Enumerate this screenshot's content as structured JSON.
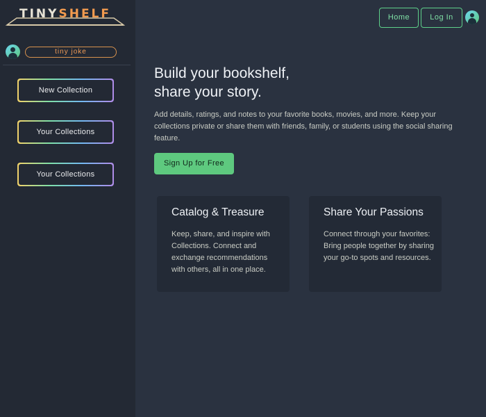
{
  "brand": {
    "part1": "TINY",
    "part2": "SHELF",
    "accent": "#f39b4f"
  },
  "sidebar": {
    "user": {
      "name": "tiny joke",
      "avatar_icon": "user-icon"
    },
    "buttons": [
      {
        "label": "New Collection"
      },
      {
        "label": "Your Collections"
      },
      {
        "label": "Your Collections"
      }
    ]
  },
  "nav": {
    "home": "Home",
    "login": "Log In",
    "avatar_icon": "user-icon"
  },
  "hero": {
    "title_line1": "Build your bookshelf,",
    "title_line2": "share your story.",
    "description": "Add details, ratings, and notes to your favorite books, movies, and more. Keep your collections private or share them with friends, family, or students using the social sharing feature.",
    "cta": "Sign Up for Free"
  },
  "cards": [
    {
      "title": "Catalog & Treasure",
      "text": "Keep, share, and inspire with Collections. Connect and exchange recommendations with others, all in one place."
    },
    {
      "title": "Share Your Passions",
      "text": "Connect through your favorites: Bring people together by sharing your go-to spots and resources."
    }
  ],
  "colors": {
    "background": "#2a3240",
    "sidebar": "#232934",
    "green": "#5ec97f",
    "orange": "#f39b4f"
  }
}
